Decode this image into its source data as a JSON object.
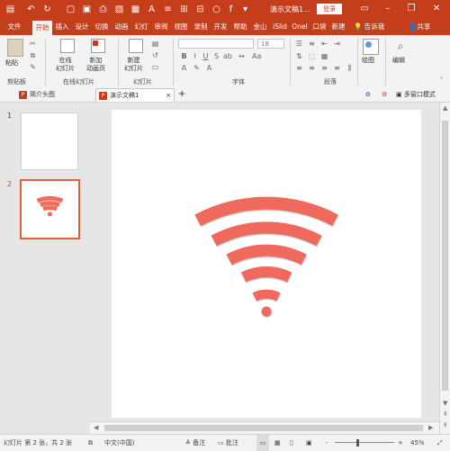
{
  "titlebar": {
    "doc_title": "演示文稿1...",
    "login": "登录",
    "quick_access": [
      "save-icon",
      "undo-icon",
      "redo-icon",
      "new-icon",
      "open-icon",
      "print-icon",
      "preview-icon",
      "grid-icon",
      "textbox-icon",
      "list-icon",
      "table-icon",
      "circle-icon",
      "fx-icon",
      "customize-icon"
    ],
    "window_controls": [
      "ribbon-options-icon",
      "minimize-icon",
      "restore-icon",
      "close-icon"
    ]
  },
  "tabs": [
    "文件",
    "开始",
    "插入",
    "设计",
    "切换",
    "动画",
    "幻灯",
    "审阅",
    "视图",
    "录制",
    "开发",
    "帮助",
    "金山",
    "iSlid",
    "OneI",
    "口袋",
    "新建"
  ],
  "active_tab": "开始",
  "tell_me": "告诉我",
  "share": "共享",
  "ribbon": {
    "clipboard": {
      "paste": "粘贴",
      "label": "剪贴板"
    },
    "online_slides": {
      "in_online": "在线",
      "slides": "幻灯片",
      "new_anim": "新加",
      "anim_page": "动画页",
      "label": "在线幻灯片"
    },
    "slides": {
      "new_slide": "新建",
      "slide": "幻灯片",
      "label": "幻灯片"
    },
    "font": {
      "font_name": "",
      "font_size": "18",
      "label": "字体"
    },
    "paragraph": {
      "label": "段落"
    },
    "drawing": {
      "label": "绘图"
    },
    "editing": {
      "label": "编辑"
    }
  },
  "doc_tabs": {
    "tab1": "简介头图",
    "tab2": "演示文稿1",
    "add": "+",
    "multi_window": "多窗口模式"
  },
  "thumbnails": [
    {
      "number": "1"
    },
    {
      "number": "2"
    }
  ],
  "status": {
    "slide_info": "幻灯片 第 2 张，共 2 张",
    "language": "中文(中国)",
    "notes": "备注",
    "comments": "批注",
    "zoom": "45%",
    "zoom_minus": "-",
    "zoom_plus": "+"
  },
  "colors": {
    "brand": "#c43e1c",
    "wifi": "#ef6b5c"
  }
}
